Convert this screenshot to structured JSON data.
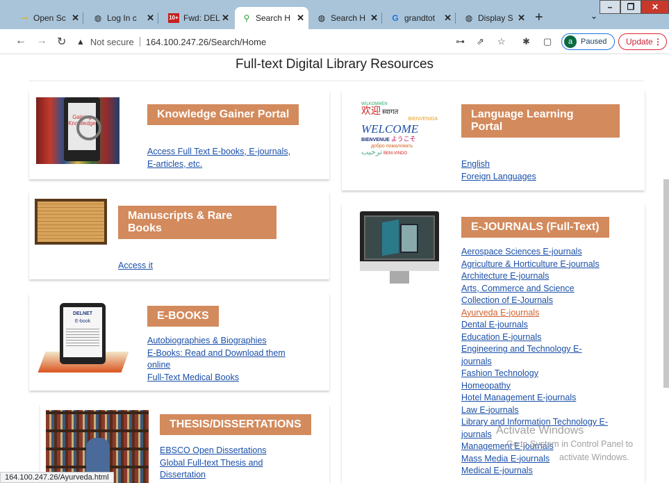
{
  "tabs": [
    {
      "label": "Open Sc",
      "icon": "key-icon"
    },
    {
      "label": "Log In c",
      "icon": "globe-icon"
    },
    {
      "label": "Fwd: DEL",
      "icon": "gmail-icon"
    },
    {
      "label": "Search H",
      "icon": "search-icon"
    },
    {
      "label": "Search H",
      "icon": "globe-icon"
    },
    {
      "label": "grandtot",
      "icon": "google-icon"
    },
    {
      "label": "Display S",
      "icon": "globe-icon"
    }
  ],
  "gmail_badge": "10+",
  "address": {
    "security": "Not secure",
    "url": "164.100.247.26/Search/Home"
  },
  "profile": {
    "initial": "a",
    "status": "Paused"
  },
  "update_label": "Update",
  "page_title": "Full-text Digital Library Resources",
  "knowledge": {
    "button": "Knowledge Gainer Portal",
    "links": [
      "Access Full Text E-books, E-journals,",
      "E-articles, etc."
    ],
    "image_text": [
      "Gaining",
      "Knowledge"
    ]
  },
  "language": {
    "button": [
      "Language Learning",
      "Portal"
    ],
    "links": [
      "English",
      "Foreign Languages"
    ],
    "image_words": [
      "WILKOMMEN",
      "欢迎",
      "स्वागत",
      "BIENVENIDA",
      "WELCOME",
      "BIENVENUE",
      "ようこそ",
      "добро пожаловать",
      "ترحيب",
      "BEM-VINDO"
    ]
  },
  "manuscripts": {
    "button": [
      "Manuscripts & Rare",
      "Books"
    ],
    "link": "Access it"
  },
  "ebooks": {
    "button": "E-BOOKS",
    "links": [
      "Autobiographies & Biographies",
      "E-Books: Read and Download them",
      "online",
      "Full-Text Medical Books"
    ],
    "image_text": [
      "DELNET",
      "E-book"
    ]
  },
  "ejournals": {
    "button": "E-JOURNALS (Full-Text)",
    "links": [
      "Aerospace Sciences E-journals",
      "Agriculture & Horticulture E-journals",
      "Architecture E-journals",
      "Arts, Commerce and Science",
      "Collection of E-Journals",
      "Ayurveda E-journals",
      "Dental E-journals",
      "Education E-journals",
      "Engineering and Technology E-",
      "journals",
      "Fashion Technology",
      "Homeopathy",
      "Hotel Management E-journals",
      "Law E-journals",
      "Library and Information Technology E-",
      "journals",
      "Management E-journals",
      "Mass Media E-journals",
      "Medical E-journals"
    ]
  },
  "thesis": {
    "button": "THESIS/DISSERTATIONS",
    "links": [
      "EBSCO Open Dissertations",
      "Global Full-text Thesis and",
      "Dissertation"
    ]
  },
  "status_url": "164.100.247.26/Ayurveda.html",
  "watermark": [
    "Activate Windows",
    "Go to System in Control Panel to",
    "activate Windows."
  ],
  "colors": {
    "accent": "#d38a5c",
    "link": "#1a4fa8",
    "hover": "#d1602e",
    "tabbar": "#a9c4d9"
  }
}
